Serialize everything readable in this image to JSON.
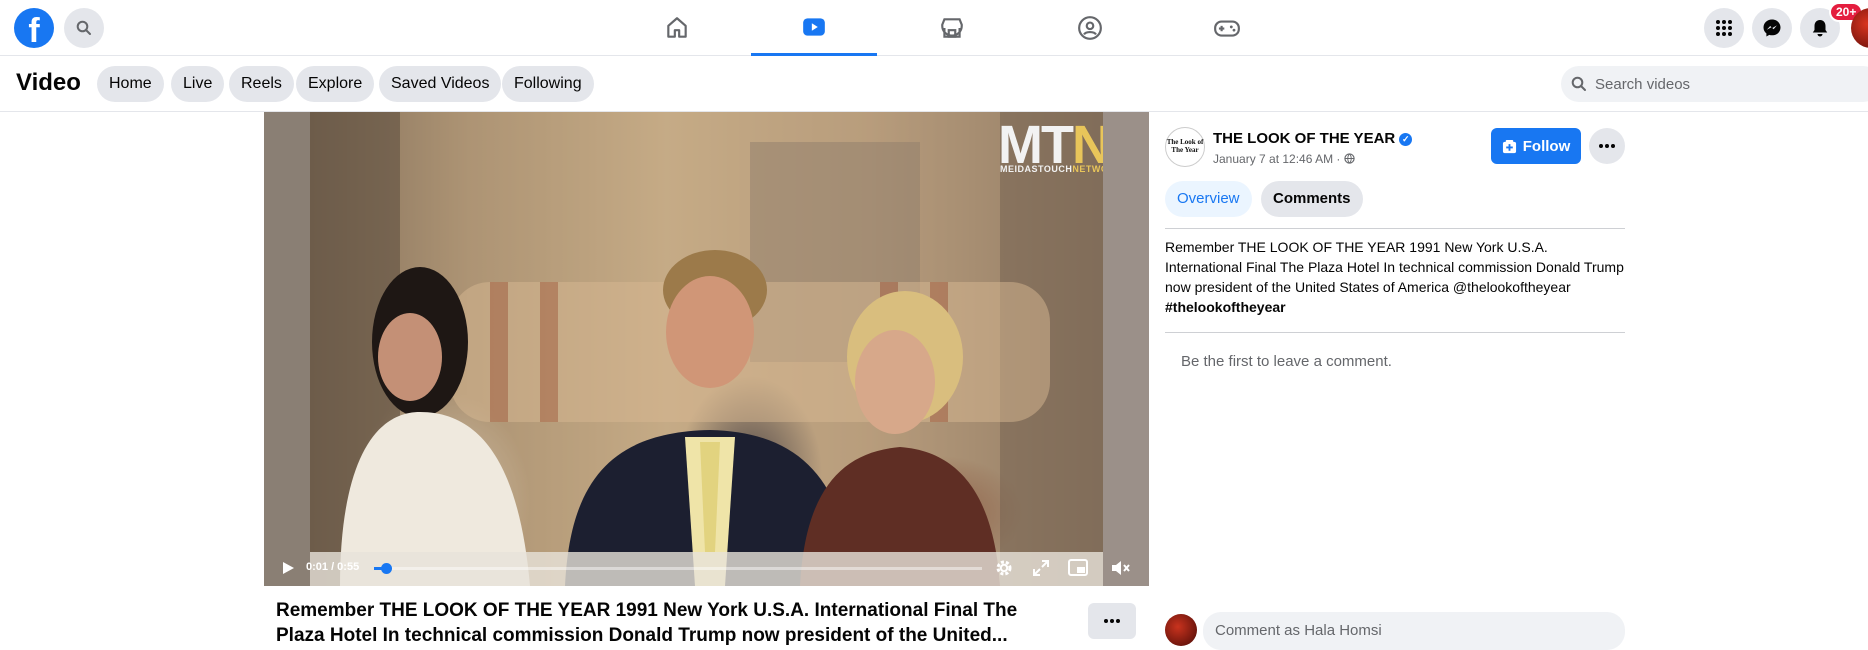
{
  "topbar": {
    "logo": "f",
    "notifications_badge": "20+",
    "nav_tabs": [
      {
        "name": "home",
        "icon": "home-icon"
      },
      {
        "name": "video",
        "icon": "video-icon",
        "active": true
      },
      {
        "name": "marketplace",
        "icon": "marketplace-icon"
      },
      {
        "name": "groups",
        "icon": "groups-icon"
      },
      {
        "name": "gaming",
        "icon": "gaming-icon"
      }
    ],
    "accent_color": "#1877f2"
  },
  "subbar": {
    "title": "Video",
    "pills": [
      "Home",
      "Live",
      "Reels",
      "Explore",
      "Saved Videos",
      "Following"
    ],
    "search_placeholder": "Search videos"
  },
  "video": {
    "watermark_main": "MT",
    "watermark_accent": "N",
    "watermark_sub": "MEIDASTOUCH",
    "watermark_sub_accent": "NETWORK",
    "time": "0:01 / 0:55",
    "progress": 0.02,
    "title": "Remember THE LOOK OF THE YEAR 1991 New York U.S.A. International Final The Plaza Hotel In technical commission Donald Trump now president of the United..."
  },
  "panel": {
    "channel_avatar_text": "The Look of The Year",
    "channel_name": "THE LOOK OF THE YEAR",
    "verified": "✓",
    "posted": "January 7 at 12:46 AM · ",
    "follow_label": "Follow",
    "tabs": [
      {
        "label": "Overview",
        "active": true
      },
      {
        "label": "Comments",
        "active": false
      }
    ],
    "description": "Remember THE LOOK OF THE YEAR 1991 New York U.S.A. International Final The Plaza Hotel In technical commission Donald Trump now president of the United States of America @thelookoftheyear ",
    "hashtag": "#thelookoftheyear",
    "no_comments": "Be the first to leave a comment.",
    "comment_placeholder": "Comment as Hala Homsi"
  }
}
